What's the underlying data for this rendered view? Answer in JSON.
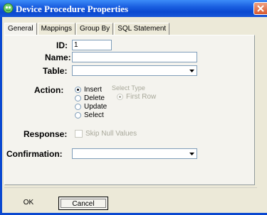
{
  "window": {
    "title": "Device Procedure Properties"
  },
  "tabs": [
    "General",
    "Mappings",
    "Group By",
    "SQL Statement"
  ],
  "form": {
    "id_label": "ID:",
    "id_value": "1",
    "name_label": "Name:",
    "name_value": "",
    "table_label": "Table:",
    "table_value": "",
    "action_label": "Action:",
    "actions": [
      "Insert",
      "Delete",
      "Update",
      "Select"
    ],
    "action_selected": "Insert",
    "select_type_label": "Select Type",
    "first_row_label": "First Row",
    "response_label": "Response:",
    "skip_null_label": "Skip Null Values",
    "confirmation_label": "Confirmation:",
    "confirmation_value": ""
  },
  "buttons": {
    "ok": "OK",
    "cancel": "Cancel"
  },
  "colors": {
    "title_bar": "#0a48d0",
    "close_button": "#d85a30",
    "dialog_bg": "#ece9d8",
    "field_border": "#7f9db9"
  }
}
